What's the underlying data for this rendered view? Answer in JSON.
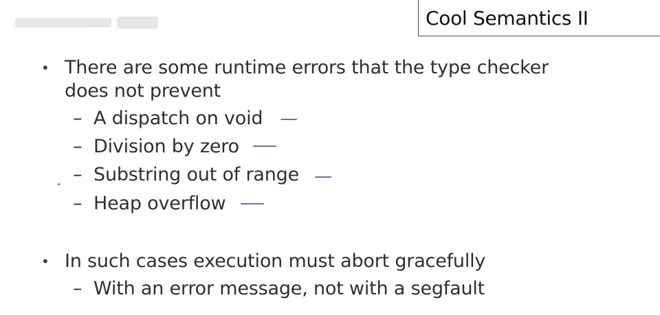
{
  "slide": {
    "title": "Cool Semantics II",
    "bullets": [
      {
        "text": "There are some runtime errors that the type checker does not prevent",
        "subitems": [
          "A dispatch on void",
          "Division by zero",
          "Substring out of range",
          "Heap overflow"
        ]
      },
      {
        "text": "In such cases execution must abort gracefully",
        "subitems": [
          "With an error message, not with a segfault"
        ]
      }
    ],
    "bullet_glyph": "•",
    "dash_glyph": "–"
  }
}
